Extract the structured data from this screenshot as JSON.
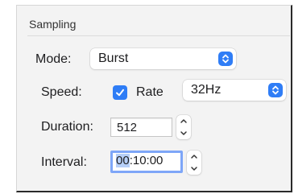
{
  "section": {
    "title": "Sampling"
  },
  "mode": {
    "label": "Mode:",
    "value": "Burst"
  },
  "speed": {
    "label": "Speed:",
    "rate_label": "Rate",
    "rate_checked": true,
    "rate_value": "32Hz"
  },
  "duration": {
    "label": "Duration:",
    "value": "512"
  },
  "interval": {
    "label": "Interval:",
    "value_selected": "00",
    "value_rest": ":10:00"
  },
  "colors": {
    "accent": "#2f7df6",
    "focus_ring": "#7ea6f8",
    "selection": "#b6cff8"
  },
  "icons": {
    "popup": "chevron-up-down-icon",
    "check": "checkmark-icon",
    "stepper_up": "chevron-up-icon",
    "stepper_down": "chevron-down-icon"
  }
}
